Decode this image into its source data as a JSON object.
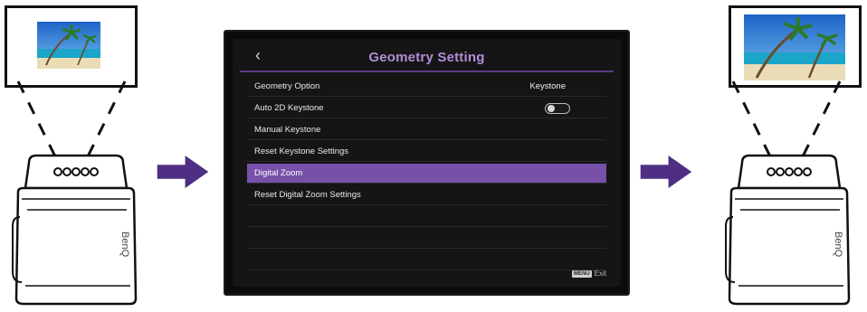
{
  "osd": {
    "title": "Geometry Setting",
    "back_icon": "chevron-left-icon",
    "items": [
      {
        "label": "Geometry Option",
        "value": "Keystone",
        "control": "value"
      },
      {
        "label": "Auto 2D Keystone",
        "value": "",
        "control": "toggle-off"
      },
      {
        "label": "Manual Keystone",
        "value": "",
        "control": "none"
      },
      {
        "label": "Reset Keystone Settings",
        "value": "",
        "control": "none"
      },
      {
        "label": "Digital Zoom",
        "value": "",
        "control": "selected"
      },
      {
        "label": "Reset Digital Zoom Settings",
        "value": "",
        "control": "none"
      }
    ],
    "footer": {
      "key_label": "MENU",
      "action": "Exit"
    }
  },
  "projector_brand": "BenQ",
  "colors": {
    "accent": "#7650a9",
    "title": "#b08ed8",
    "arrow": "#4f2f83"
  }
}
